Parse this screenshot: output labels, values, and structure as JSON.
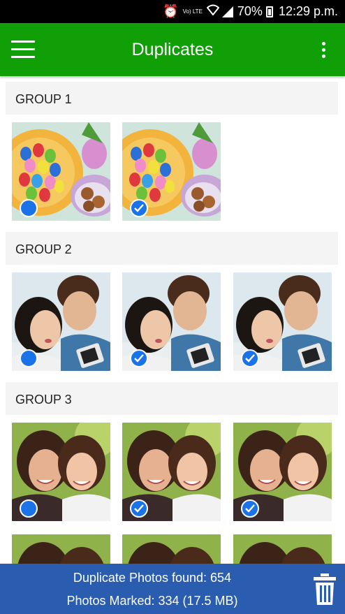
{
  "status_bar": {
    "lte_label": "Vo) LTE",
    "battery": "70%",
    "time": "12:29 p.m."
  },
  "app_bar": {
    "title": "Duplicates",
    "menu_icon": "hamburger-icon",
    "more_icon": "overflow-menu-icon"
  },
  "groups": [
    {
      "label": "GROUP 1",
      "photos": [
        {
          "subject": "easter-eggs-bowl",
          "marked": false
        },
        {
          "subject": "easter-eggs-bowl",
          "marked": true
        }
      ]
    },
    {
      "label": "GROUP 2",
      "photos": [
        {
          "subject": "couple-selfie",
          "marked": false
        },
        {
          "subject": "couple-selfie",
          "marked": true
        },
        {
          "subject": "couple-selfie",
          "marked": true
        }
      ]
    },
    {
      "label": "GROUP 3",
      "photos": [
        {
          "subject": "two-women-smiling",
          "marked": false
        },
        {
          "subject": "two-women-smiling",
          "marked": true
        },
        {
          "subject": "two-women-smiling",
          "marked": true
        }
      ]
    }
  ],
  "bottom_bar": {
    "found_text": "Duplicate Photos found: 654",
    "marked_text": "Photos Marked: 334 (17.5 MB)",
    "delete_icon": "trash-icon"
  },
  "colors": {
    "app_bar": "#119f07",
    "bottom_bar": "#2a5db0",
    "check": "#1a73e8"
  }
}
